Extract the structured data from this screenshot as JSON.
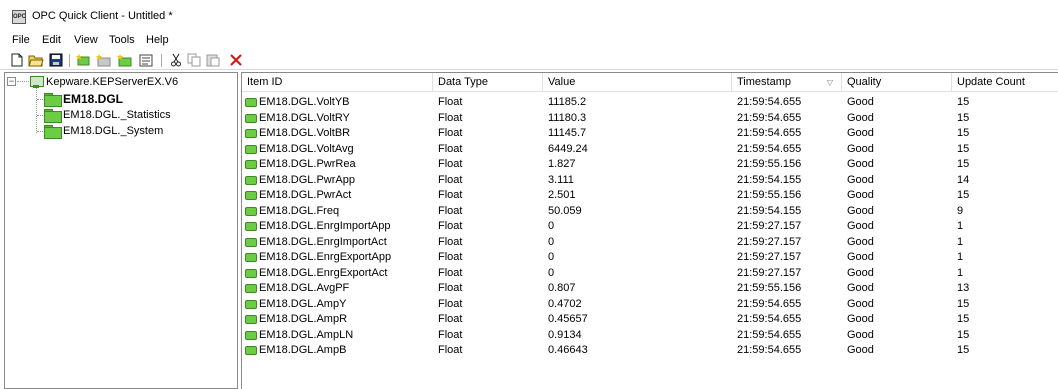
{
  "window": {
    "title": "OPC Quick Client - Untitled *",
    "app_icon": "OPC"
  },
  "menu": [
    "File",
    "Edit",
    "View",
    "Tools",
    "Help"
  ],
  "toolbar": [
    "new-icon",
    "open-icon",
    "save-icon",
    "new-server-icon",
    "new-group-icon",
    "new-item-icon",
    "properties-icon",
    "cut-icon",
    "copy-icon",
    "paste-icon",
    "delete-icon"
  ],
  "tree": {
    "expander": "−",
    "root": "Kepware.KEPServerEX.V6",
    "children": [
      "EM18.DGL",
      "EM18.DGL._Statistics",
      "EM18.DGL._System"
    ]
  },
  "list": {
    "columns": [
      "Item ID",
      "Data Type",
      "Value",
      "Timestamp",
      "Quality",
      "Update Count"
    ],
    "sort_indicator": "▽",
    "rows": [
      [
        "EM18.DGL.VoltYB",
        "Float",
        "11185.2",
        "21:59:54.655",
        "Good",
        "15"
      ],
      [
        "EM18.DGL.VoltRY",
        "Float",
        "11180.3",
        "21:59:54.655",
        "Good",
        "15"
      ],
      [
        "EM18.DGL.VoltBR",
        "Float",
        "11145.7",
        "21:59:54.655",
        "Good",
        "15"
      ],
      [
        "EM18.DGL.VoltAvg",
        "Float",
        "6449.24",
        "21:59:54.655",
        "Good",
        "15"
      ],
      [
        "EM18.DGL.PwrRea",
        "Float",
        "1.827",
        "21:59:55.156",
        "Good",
        "15"
      ],
      [
        "EM18.DGL.PwrApp",
        "Float",
        "3.111",
        "21:59:54.155",
        "Good",
        "14"
      ],
      [
        "EM18.DGL.PwrAct",
        "Float",
        "2.501",
        "21:59:55.156",
        "Good",
        "15"
      ],
      [
        "EM18.DGL.Freq",
        "Float",
        "50.059",
        "21:59:54.155",
        "Good",
        "9"
      ],
      [
        "EM18.DGL.EnrgImportApp",
        "Float",
        "0",
        "21:59:27.157",
        "Good",
        "1"
      ],
      [
        "EM18.DGL.EnrgImportAct",
        "Float",
        "0",
        "21:59:27.157",
        "Good",
        "1"
      ],
      [
        "EM18.DGL.EnrgExportApp",
        "Float",
        "0",
        "21:59:27.157",
        "Good",
        "1"
      ],
      [
        "EM18.DGL.EnrgExportAct",
        "Float",
        "0",
        "21:59:27.157",
        "Good",
        "1"
      ],
      [
        "EM18.DGL.AvgPF",
        "Float",
        "0.807",
        "21:59:55.156",
        "Good",
        "13"
      ],
      [
        "EM18.DGL.AmpY",
        "Float",
        "0.4702",
        "21:59:54.655",
        "Good",
        "15"
      ],
      [
        "EM18.DGL.AmpR",
        "Float",
        "0.45657",
        "21:59:54.655",
        "Good",
        "15"
      ],
      [
        "EM18.DGL.AmpLN",
        "Float",
        "0.9134",
        "21:59:54.655",
        "Good",
        "15"
      ],
      [
        "EM18.DGL.AmpB",
        "Float",
        "0.46643",
        "21:59:54.655",
        "Good",
        "15"
      ]
    ]
  }
}
